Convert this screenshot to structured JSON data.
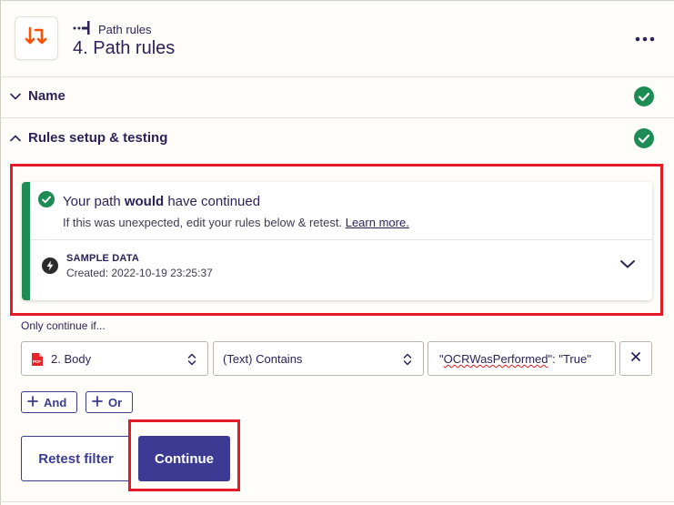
{
  "colors": {
    "brand_orange": "#ff4f00",
    "success_green": "#1d8c54",
    "primary_button": "#3d3a94",
    "text": "#2b2358",
    "highlight_red": "#e41b26"
  },
  "header": {
    "app_icon": "paths-icon",
    "step_type_icon": "path-branch-icon",
    "step_type_label": "Path rules",
    "title": "4. Path rules",
    "more_icon": "more-horizontal-icon"
  },
  "sections": [
    {
      "label": "Name",
      "expanded": false,
      "status_icon": "check-circle-icon"
    },
    {
      "label": "Rules setup & testing",
      "expanded": true,
      "status_icon": "check-circle-icon"
    }
  ],
  "result": {
    "prefix": "Your path ",
    "emphasis": "would",
    "suffix": " have continued",
    "hint": "If this was unexpected, edit your rules below & retest. ",
    "link": "Learn more.",
    "sample_title": "SAMPLE DATA",
    "sample_created": "Created: 2022-10-19 23:25:37"
  },
  "filter": {
    "label": "Only continue if...",
    "field": {
      "icon": "pdf-icon",
      "value": "2. Body"
    },
    "operator": "(Text) Contains",
    "value_quote_open": "\"",
    "value_word": "OCRWasPerformed",
    "value_rest": "\": \"True\"",
    "and_label": "And",
    "or_label": "Or"
  },
  "actions": {
    "retest_label": "Retest filter",
    "continue_label": "Continue"
  }
}
